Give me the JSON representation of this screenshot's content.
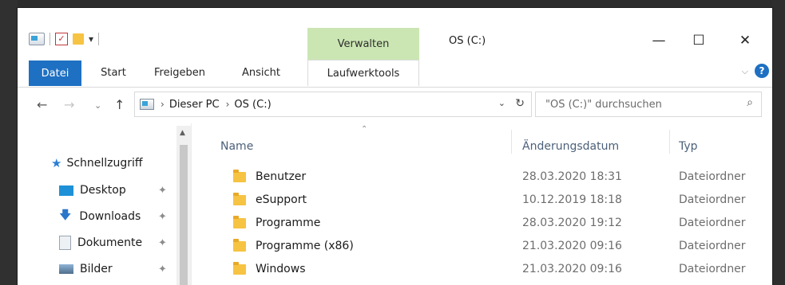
{
  "window": {
    "title": "OS (C:)",
    "context_tab_group": "Verwalten"
  },
  "quick_access_toolbar": {
    "icons": [
      "drive-icon",
      "properties-checkbox-icon",
      "new-folder-icon",
      "customize-dropdown-icon"
    ]
  },
  "window_controls": {
    "minimize": "—",
    "maximize": "☐",
    "close": "✕"
  },
  "ribbon": {
    "tabs": [
      {
        "label": "Datei"
      },
      {
        "label": "Start"
      },
      {
        "label": "Freigeben"
      },
      {
        "label": "Ansicht"
      },
      {
        "label": "Laufwerktools"
      }
    ]
  },
  "address": {
    "breadcrumbs": [
      "Dieser PC",
      "OS (C:)"
    ],
    "search_placeholder": "\"OS (C:)\" durchsuchen"
  },
  "navigation_pane": {
    "header": "Schnellzugriff",
    "items": [
      {
        "label": "Desktop",
        "icon": "desktop-icon",
        "color": "#1e90d8"
      },
      {
        "label": "Downloads",
        "icon": "download-arrow-icon",
        "color": "#2a76c9"
      },
      {
        "label": "Dokumente",
        "icon": "document-icon",
        "color": "#9aa5b1"
      },
      {
        "label": "Bilder",
        "icon": "pictures-icon",
        "color": "#4f6e8c"
      }
    ]
  },
  "file_list": {
    "columns": [
      "Name",
      "Änderungsdatum",
      "Typ"
    ],
    "rows": [
      {
        "name": "Benutzer",
        "date": "28.03.2020 18:31",
        "type": "Dateiordner"
      },
      {
        "name": "eSupport",
        "date": "10.12.2019 18:18",
        "type": "Dateiordner"
      },
      {
        "name": "Programme",
        "date": "28.03.2020 19:12",
        "type": "Dateiordner"
      },
      {
        "name": "Programme (x86)",
        "date": "21.03.2020 09:16",
        "type": "Dateiordner"
      },
      {
        "name": "Windows",
        "date": "21.03.2020 09:16",
        "type": "Dateiordner"
      }
    ]
  },
  "colors": {
    "accent": "#1e70c2",
    "context_tab": "#cbe6b3",
    "folder": "#f6c343"
  }
}
